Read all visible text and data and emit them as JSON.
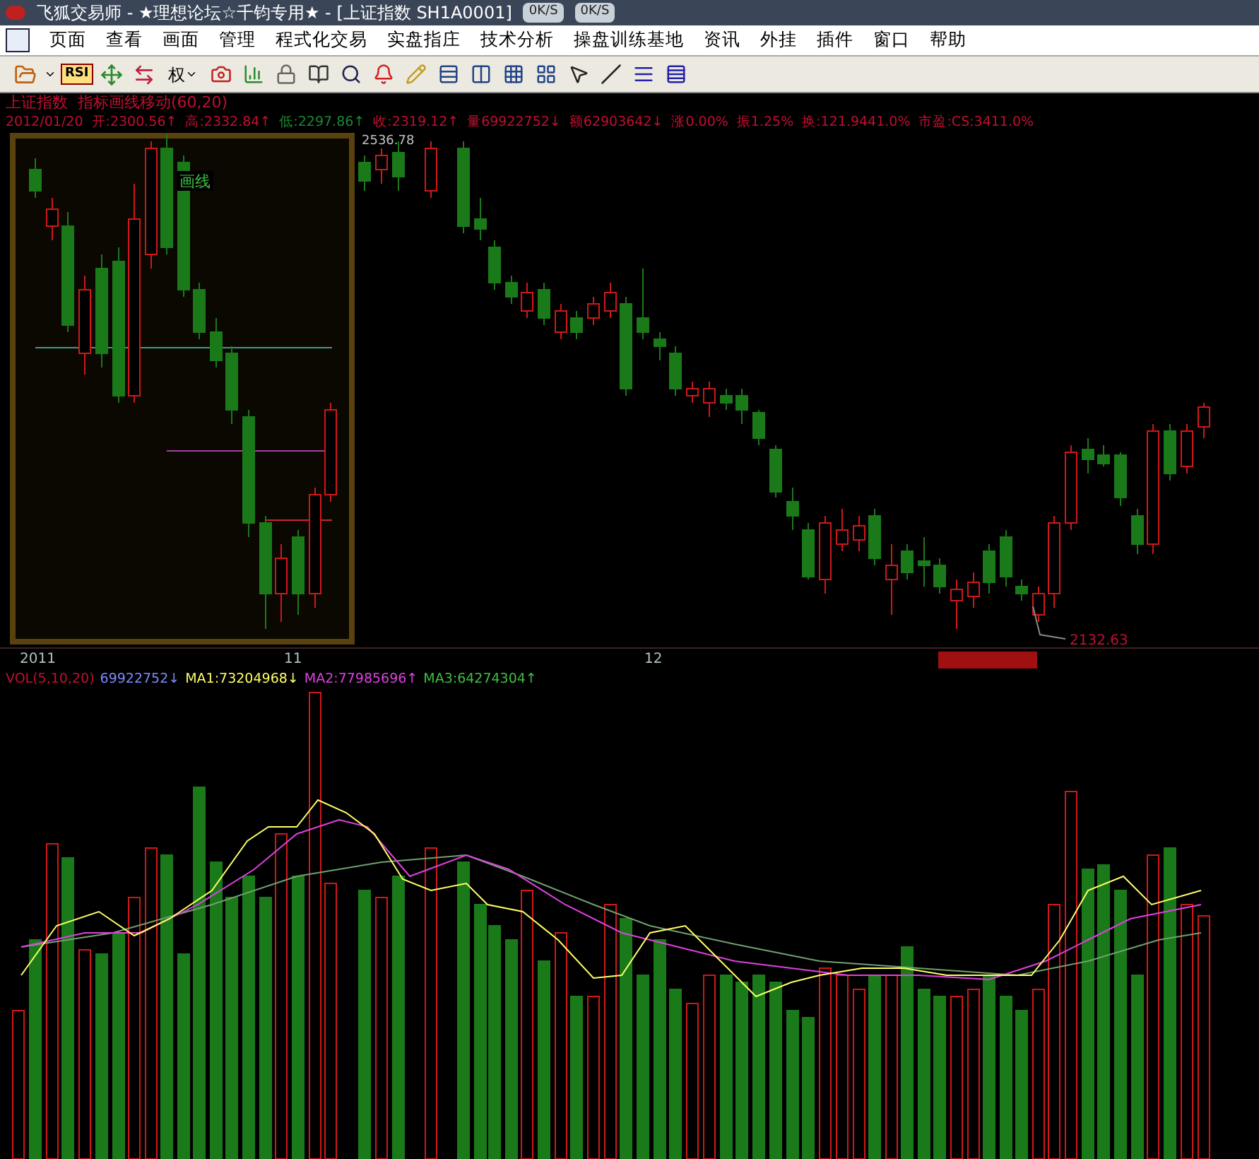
{
  "title_bar": {
    "title": "飞狐交易师 - ★理想论坛☆千钧专用★ - [上证指数 SH1A0001]",
    "net_speed": [
      "0K/S",
      "0K/S"
    ]
  },
  "menu": [
    "页面",
    "查看",
    "画面",
    "管理",
    "程式化交易",
    "实盘指庄",
    "技术分析",
    "操盘训练基地",
    "资讯",
    "外挂",
    "插件",
    "窗口",
    "帮助"
  ],
  "toolbar": {
    "rsi_label": "RSI",
    "rights_label": "权"
  },
  "chart": {
    "title": "上证指数  指标画线移动(60,20)",
    "info": [
      {
        "text": "2012/01/20",
        "color": "#c01030"
      },
      {
        "text": "开:2300.56↑",
        "color": "#c01030"
      },
      {
        "text": "高:2332.84↑",
        "color": "#c01030"
      },
      {
        "text": "低:2297.86↑",
        "color": "#1a8a30"
      },
      {
        "text": "收:2319.12↑",
        "color": "#c01030"
      },
      {
        "text": "量69922752↓",
        "color": "#c01030"
      },
      {
        "text": "额62903642↓",
        "color": "#c01030"
      },
      {
        "text": "涨0.00%",
        "color": "#c01030"
      },
      {
        "text": "振1.25%",
        "color": "#c01030"
      },
      {
        "text": "换:121.9441.0%",
        "color": "#c01030"
      },
      {
        "text": "市盈:CS:3411.0%",
        "color": "#c01030"
      }
    ],
    "overlay_label": "画线",
    "high_label": "2536.78",
    "low_label": "2132.63",
    "x_axis": [
      "2011",
      "11",
      "12"
    ]
  },
  "volume": {
    "header": [
      {
        "text": "VOL(5,10,20)",
        "color": "#c01030"
      },
      {
        "text": "69922752↓",
        "color": "#7d8cff"
      },
      {
        "text": "MA1:73204968↓",
        "color": "#ffff66"
      },
      {
        "text": "MA2:77985696↑",
        "color": "#e040e0"
      },
      {
        "text": "MA3:64274304↑",
        "color": "#40c040"
      }
    ]
  }
}
